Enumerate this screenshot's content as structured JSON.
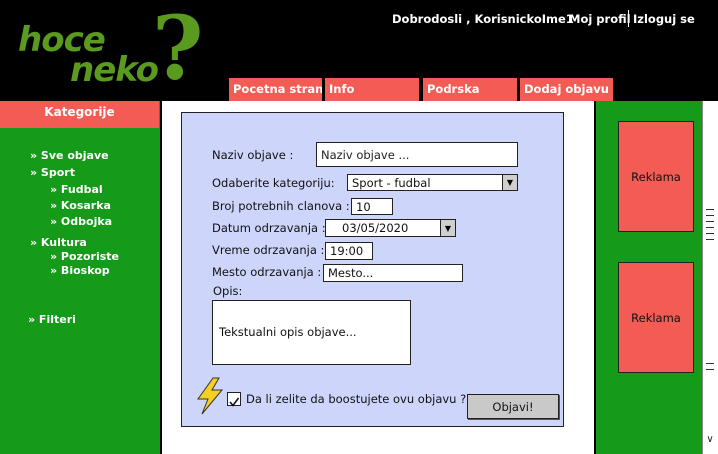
{
  "logo": {
    "word1": "hoce",
    "word2": "neko",
    "mark": "?"
  },
  "user": {
    "welcome": "Dobrodosli , KorisnickoIme1",
    "profile_link": "Moj profil",
    "logout_link": "Izloguj se"
  },
  "nav": {
    "home": "Pocetna strana",
    "info": "Info",
    "support": "Podrska",
    "add_post": "Dodaj objavu"
  },
  "sidebar": {
    "header": "Kategorije",
    "all_posts": "» Sve objave",
    "sport": "» Sport",
    "football": "» Fudbal",
    "basketball": "» Kosarka",
    "volleyball": "» Odbojka",
    "culture": "» Kultura",
    "theatre": "» Pozoriste",
    "cinema": "» Bioskop",
    "filters": "» Filteri"
  },
  "form": {
    "title_label": "Naziv objave :",
    "title_placeholder": "Naziv objave ...",
    "category_label": "Odaberite kategoriju:",
    "category_value": "Sport - fudbal",
    "members_label": "Broj potrebnih clanova :",
    "members_value": "10",
    "date_label": "Datum odrzavanja :",
    "date_value": "03/05/2020",
    "time_label": "Vreme odrzavanja :",
    "time_value": "19:00",
    "place_label": "Mesto odrzavanja :",
    "place_placeholder": "Mesto...",
    "description_label": "Opis:",
    "description_placeholder": "Tekstualni opis objave...",
    "boost_label": "Da li zelite da boostujete ovu objavu ?",
    "boost_checked": true,
    "submit_label": "Objavi!"
  },
  "ads": {
    "ad1": "Reklama",
    "ad2": "Reklama"
  },
  "colors": {
    "header_bg": "#000000",
    "nav_tab": "#f25c54",
    "sidebar_green": "#169a19",
    "form_bg": "#cdd5fb",
    "logo_green": "#5a9a1f",
    "bolt": "#f5d020"
  },
  "icons": {
    "boost": "lightning-bolt-icon",
    "dropdown": "triangle-down-icon",
    "check": "checkmark-icon"
  }
}
